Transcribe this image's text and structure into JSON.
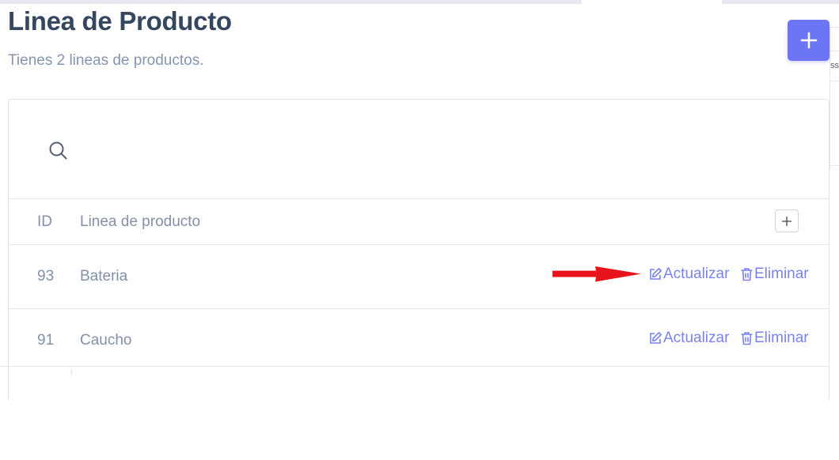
{
  "header": {
    "title": "Linea de Producto",
    "subtitle": "Tienes 2 lineas de productos.",
    "add_icon": "plus-icon",
    "accent_color": "#6c75f5"
  },
  "right_edge_fragment": "ss",
  "search": {
    "icon": "search-icon",
    "value": "",
    "placeholder": ""
  },
  "table": {
    "columns": {
      "id": "ID",
      "name": "Linea de producto"
    },
    "expand_icon": "plus-icon",
    "rows": [
      {
        "id": "93",
        "name": "Bateria",
        "update_label": "Actualizar",
        "delete_label": "Eliminar"
      },
      {
        "id": "91",
        "name": "Caucho",
        "update_label": "Actualizar",
        "delete_label": "Eliminar"
      }
    ],
    "update_icon": "edit-icon",
    "delete_icon": "trash-icon"
  },
  "annotation": {
    "icon": "red-arrow-icon",
    "color": "#e8141b"
  }
}
